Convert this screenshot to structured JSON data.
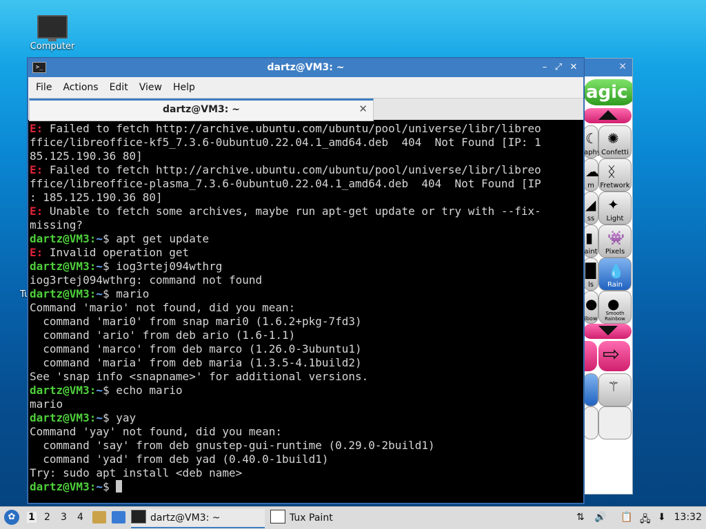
{
  "desktop": {
    "icons": [
      {
        "label": "Computer",
        "icon": "computer-icon"
      }
    ],
    "partial_label": "Tu"
  },
  "tuxpaint": {
    "close_glyph": "✕",
    "header_label": "agic",
    "tools": [
      {
        "label": "aphy",
        "icon": "moon-icon"
      },
      {
        "label": "Confetti",
        "icon": "confetti-icon"
      },
      {
        "label": "m",
        "icon": "cloud-icon"
      },
      {
        "label": "Fretwork",
        "icon": "fretwork-icon"
      },
      {
        "label": "ss",
        "icon": "glass-icon"
      },
      {
        "label": "Light",
        "icon": "flashlight-icon"
      },
      {
        "label": "aint",
        "icon": "paint-icon"
      },
      {
        "label": "Pixels",
        "icon": "pixels-icon"
      },
      {
        "label": "ls",
        "icon": "rails-icon"
      },
      {
        "label": "Rain",
        "icon": "rain-icon"
      },
      {
        "label": "ibow",
        "icon": "rainbow-icon"
      },
      {
        "label": "Smooth Rainbow",
        "icon": "smooth-rainbow-icon"
      }
    ]
  },
  "terminal": {
    "window_title": "dartz@VM3: ~",
    "menu": [
      "File",
      "Actions",
      "Edit",
      "View",
      "Help"
    ],
    "tab_title": "dartz@VM3: ~",
    "tab_close": "✕",
    "prompt_user": "dartz@VM3",
    "prompt_sep": ":",
    "prompt_path": "~",
    "prompt_sign": "$",
    "lines": [
      {
        "type": "err",
        "text": " Failed to fetch http://archive.ubuntu.com/ubuntu/pool/universe/libr/libreo"
      },
      {
        "type": "out",
        "text": "ffice/libreoffice-kf5_7.3.6-0ubuntu0.22.04.1_amd64.deb  404  Not Found [IP: 1"
      },
      {
        "type": "out",
        "text": "85.125.190.36 80]"
      },
      {
        "type": "err",
        "text": " Failed to fetch http://archive.ubuntu.com/ubuntu/pool/universe/libr/libreo"
      },
      {
        "type": "out",
        "text": "ffice/libreoffice-plasma_7.3.6-0ubuntu0.22.04.1_amd64.deb  404  Not Found [IP"
      },
      {
        "type": "out",
        "text": ": 185.125.190.36 80]"
      },
      {
        "type": "err",
        "text": " Unable to fetch some archives, maybe run apt-get update or try with --fix-"
      },
      {
        "type": "out",
        "text": "missing?"
      },
      {
        "type": "cmd",
        "text": " apt get update"
      },
      {
        "type": "err",
        "text": " Invalid operation get"
      },
      {
        "type": "cmd",
        "text": " iog3rtej094wthrg"
      },
      {
        "type": "out",
        "text": "iog3rtej094wthrg: command not found"
      },
      {
        "type": "cmd",
        "text": " mario"
      },
      {
        "type": "out",
        "text": "Command 'mario' not found, did you mean:"
      },
      {
        "type": "out",
        "text": "  command 'mari0' from snap mari0 (1.6.2+pkg-7fd3)"
      },
      {
        "type": "out",
        "text": "  command 'ario' from deb ario (1.6-1.1)"
      },
      {
        "type": "out",
        "text": "  command 'marco' from deb marco (1.26.0-3ubuntu1)"
      },
      {
        "type": "out",
        "text": "  command 'maria' from deb maria (1.3.5-4.1build2)"
      },
      {
        "type": "out",
        "text": "See 'snap info <snapname>' for additional versions."
      },
      {
        "type": "cmd",
        "text": " echo mario"
      },
      {
        "type": "out",
        "text": "mario"
      },
      {
        "type": "cmd",
        "text": " yay"
      },
      {
        "type": "out",
        "text": "Command 'yay' not found, did you mean:"
      },
      {
        "type": "out",
        "text": "  command 'say' from deb gnustep-gui-runtime (0.29.0-2build1)"
      },
      {
        "type": "out",
        "text": "  command 'yad' from deb yad (0.40.0-1build1)"
      },
      {
        "type": "out",
        "text": "Try: sudo apt install <deb name>"
      },
      {
        "type": "cmd",
        "text": " ",
        "cursor": true
      }
    ],
    "err_prefix": "E:"
  },
  "taskbar": {
    "workspaces": [
      "1",
      "2",
      "3",
      "4"
    ],
    "tasks": [
      {
        "label": "dartz@VM3: ~",
        "icon": "terminal-icon",
        "active": true
      },
      {
        "label": "Tux Paint",
        "icon": "tuxpaint-icon",
        "active": false
      }
    ],
    "clock": "13:32"
  }
}
